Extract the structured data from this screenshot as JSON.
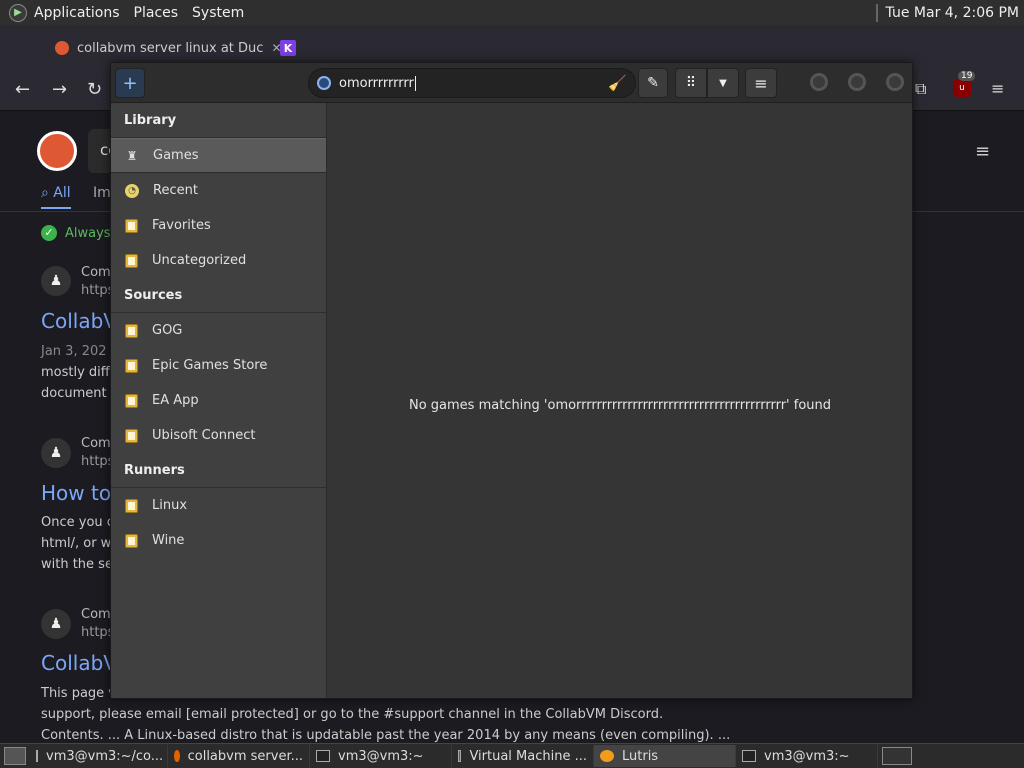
{
  "top_panel": {
    "menus": [
      "Applications",
      "Places",
      "System"
    ],
    "clock": "Tue Mar  4,  2:06 PM"
  },
  "firefox": {
    "tabs": [
      {
        "title": "collabvm server linux at Duc"
      }
    ],
    "page": {
      "search_value": "co",
      "tabs": {
        "all": "All",
        "images": "Im"
      },
      "always_label": "Always",
      "results": [
        {
          "source": "Com",
          "url": "https",
          "title": "CollabV",
          "meta": "Jan 3, 202",
          "text1": "mostly diffe",
          "text2": "document"
        },
        {
          "source": "Com",
          "url": "https",
          "title": "How to",
          "text1": "Once you c",
          "text2": "html/, or wi",
          "text3": "with the se"
        },
        {
          "source": "Com",
          "url": "https",
          "title": "CollabV",
          "text1": "This page v"
        }
      ],
      "footer_line1": "support, please email [email protected] or go to the #support channel in the CollabVM Discord.",
      "footer_line2": "Contents. ... A Linux-based distro that is updatable past the year 2014 by any means (even compiling). ..."
    },
    "ublock_count": "19"
  },
  "lutris": {
    "search_value": "omorrrrrrrrr",
    "sidebar": {
      "library_header": "Library",
      "library_items": [
        "Games",
        "Recent",
        "Favorites",
        "Uncategorized"
      ],
      "sources_header": "Sources",
      "sources_items": [
        "GOG",
        "Epic Games Store",
        "EA App",
        "Ubisoft Connect"
      ],
      "runners_header": "Runners",
      "runners_items": [
        "Linux",
        "Wine"
      ]
    },
    "empty_message": "No games matching 'omorrrrrrrrrrrrrrrrrrrrrrrrrrrrrrrrrrrrrrrrr' found"
  },
  "taskbar": {
    "tasks": [
      "vm3@vm3:~/co...",
      "collabvm server...",
      "vm3@vm3:~",
      "Virtual Machine ...",
      "Lutris",
      "vm3@vm3:~"
    ]
  }
}
